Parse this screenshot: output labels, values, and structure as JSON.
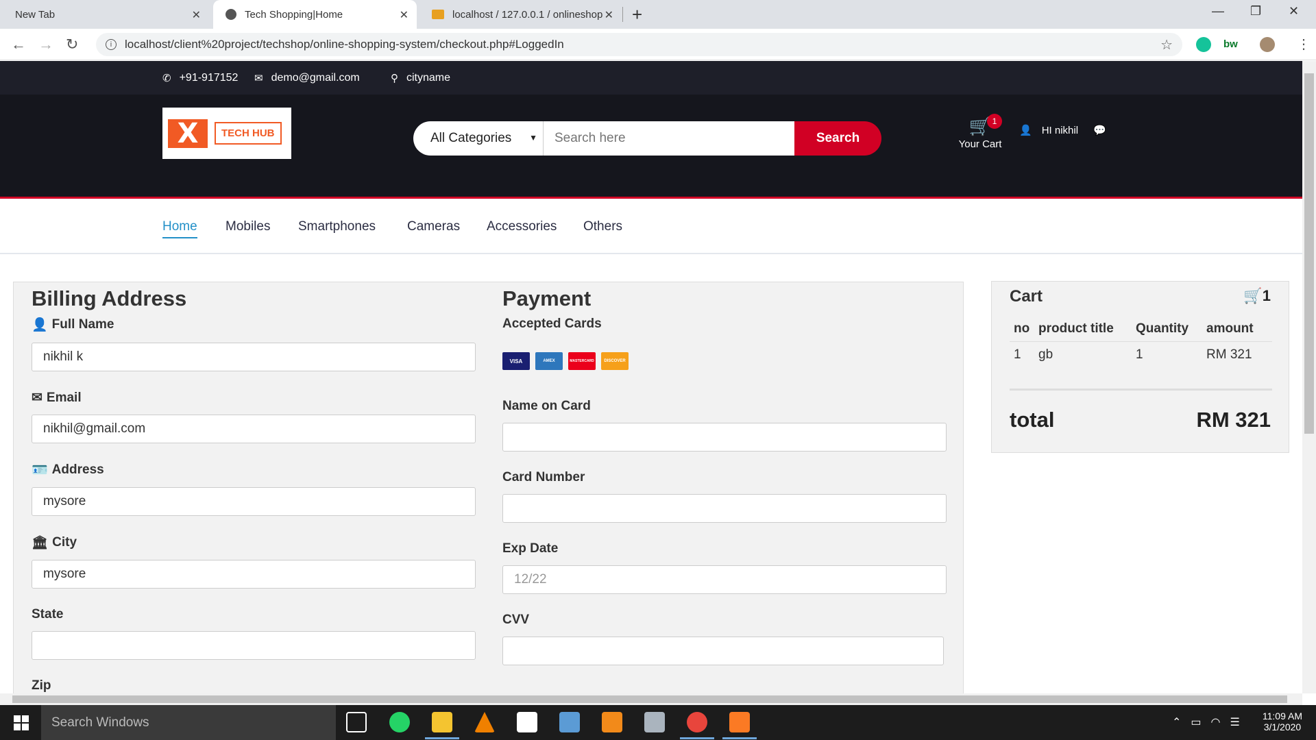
{
  "browser": {
    "tabs": [
      {
        "title": "New Tab"
      },
      {
        "title": "Tech Shopping|Home"
      },
      {
        "title": "localhost / 127.0.0.1 / onlineshop"
      }
    ],
    "url": "localhost/client%20project/techshop/online-shopping-system/checkout.php#LoggedIn"
  },
  "topbar": {
    "phone": "+91-917152",
    "email": "demo@gmail.com",
    "city": "cityname"
  },
  "header": {
    "logo_text": "TECH HUB",
    "category_label": "All Categories",
    "search_placeholder": "Search here",
    "search_button": "Search",
    "cart_label": "Your Cart",
    "cart_badge": "1",
    "greeting": "HI nikhil"
  },
  "nav": {
    "items": [
      "Home",
      "Mobiles",
      "Smartphones",
      "Cameras",
      "Accessories",
      "Others"
    ]
  },
  "billing": {
    "title": "Billing Address",
    "full_name_label": "Full Name",
    "full_name_value": "nikhil k",
    "email_label": "Email",
    "email_value": "nikhil@gmail.com",
    "address_label": "Address",
    "address_value": "mysore",
    "city_label": "City",
    "city_value": "mysore",
    "state_label": "State",
    "state_value": "",
    "zip_label": "Zip"
  },
  "payment": {
    "title": "Payment",
    "accepted_cards_label": "Accepted Cards",
    "cards": [
      "VISA",
      "AMEX",
      "MASTERCARD",
      "DISCOVER"
    ],
    "name_on_card_label": "Name on Card",
    "card_number_label": "Card Number",
    "exp_date_label": "Exp Date",
    "exp_date_placeholder": "12/22",
    "cvv_label": "CVV"
  },
  "cart": {
    "title": "Cart",
    "count": "1",
    "columns": [
      "no",
      "product title",
      "Quantity",
      "amount"
    ],
    "rows": [
      [
        "1",
        "gb",
        "1",
        "RM 321"
      ]
    ],
    "total_label": "total",
    "total_value": "RM 321"
  },
  "taskbar": {
    "search_placeholder": "Search Windows",
    "time": "11:09 AM",
    "date": "3/1/2020"
  },
  "colors": {
    "accent_red": "#d10024",
    "header_dark": "#15161d",
    "topbar_dark": "#1e1f29",
    "link_blue": "#2390c8"
  }
}
